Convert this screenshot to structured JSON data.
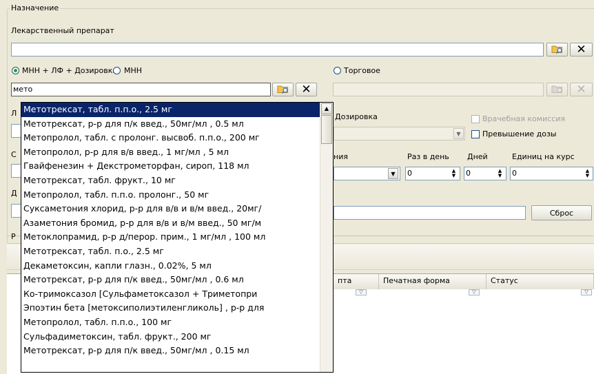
{
  "group": {
    "title": "Назначение"
  },
  "drug": {
    "label": "Лекарственный препарат",
    "value": ""
  },
  "radios": [
    {
      "label": "МНН + ЛФ + Дозировка",
      "checked": true
    },
    {
      "label": "МНН",
      "checked": false
    },
    {
      "label": "Торговое",
      "checked": false
    }
  ],
  "search": {
    "value": "мето",
    "trade_value": ""
  },
  "labels": {
    "dosage": "Дозировка",
    "commission": "Врачебная комиссия",
    "dose_excess": "Превышение дозы",
    "intake_partial": "ния",
    "per_day": "Раз в день",
    "days": "Дней",
    "units_per_course": "Единиц на курс"
  },
  "spinners": {
    "per_day": "0",
    "days": "0",
    "units": "0"
  },
  "reset_button": "Сброс",
  "table_headers": {
    "h1_partial": "пта",
    "h2": "Печатная форма",
    "h3": "Статус"
  },
  "hidden_left_chars": [
    "Л",
    "С",
    "Д",
    "Р"
  ],
  "icons": {
    "lookup": "folder-search-icon",
    "clear": "close-x-icon"
  },
  "dropdown": {
    "selected_index": 0,
    "items": [
      "Метотрексат, табл. п.п.о., 2.5 мг",
      "Метотрексат, р-р для п/к введ., 50мг/мл , 0.5 мл",
      "Метопролол, табл. с пролонг. высвоб. п.п.о., 200 мг",
      "Метопролол, р-р для в/в введ., 1 мг/мл , 5 мл",
      "Гвайфенезин + Декстрометорфан, сироп, 118 мл",
      "Метотрексат, табл. фрукт., 10 мг",
      "Метопролол, табл. п.п.о. пролонг., 50 мг",
      "Суксаметония хлорид, р-р для в/в и в/м введ., 20мг/",
      "Азаметония бромид, р-р для в/в и в/м введ., 50 мг/м",
      "Метоклопрамид, р-р д/перор. прим., 1 мг/мл , 100 мл",
      "Метотрексат, табл. п.о., 2.5 мг",
      "Декаметоксин, капли глазн., 0.02%, 5 мл",
      "Метотрексат, р-р для п/к введ., 50мг/мл , 0.6 мл",
      "Ко-тримоксазол [Сульфаметоксазол + Триметопри",
      "Эпоэтин бета [метоксиполиэтиленгликоль] , р-р для",
      "Метопролол, табл. п.п.о., 100 мг",
      "Сульфадиметоксин, табл. фрукт., 200 мг",
      "Метотрексат, р-р для п/к введ., 50мг/мл , 0.15 мл"
    ]
  }
}
